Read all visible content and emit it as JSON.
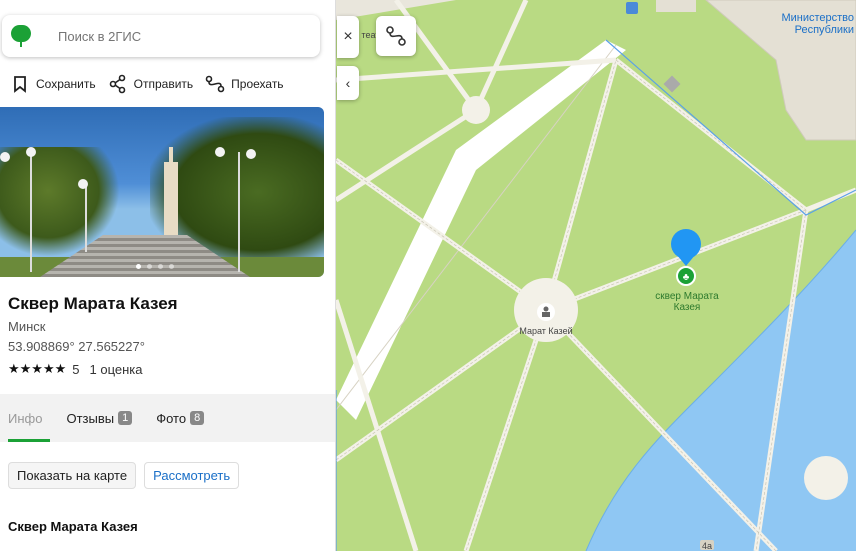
{
  "search": {
    "placeholder": "Поиск в 2ГИС",
    "logo_icon": "2gis-logo-icon"
  },
  "actions": [
    {
      "label": "Сохранить",
      "icon": "bookmark-icon"
    },
    {
      "label": "Отправить",
      "icon": "share-icon"
    },
    {
      "label": "Проехать",
      "icon": "route-icon"
    }
  ],
  "place": {
    "title": "Сквер Марата Казея",
    "city": "Минск",
    "coords": "53.908869° 27.565227°",
    "stars": "★★★★★",
    "score": "5",
    "reviews_count": "1 оценка"
  },
  "tabs": [
    {
      "label": "Инфо",
      "badge": null,
      "active": true
    },
    {
      "label": "Отзывы",
      "badge": "1",
      "active": false
    },
    {
      "label": "Фото",
      "badge": "8",
      "active": false
    }
  ],
  "buttons": {
    "show_on_map": "Показать на карте",
    "view": "Рассмотреть"
  },
  "section_title": "Сквер Марата Казея",
  "controls": {
    "close": "×",
    "collapse": "‹"
  },
  "map": {
    "marker_label": "сквер Марата Казея",
    "monument_label": "Марат Казей",
    "building_label": "Министерство Республики",
    "fragment_label": "театр",
    "house_number": "4а",
    "colors": {
      "park": "#b9da83",
      "path": "#f3f1e8",
      "water": "#8fc7f3",
      "building": "#e4e0d4",
      "marker": "#2196f3",
      "accent": "#1ba136"
    }
  },
  "gallery": {
    "dot_count": 4,
    "active_dot": 0
  }
}
